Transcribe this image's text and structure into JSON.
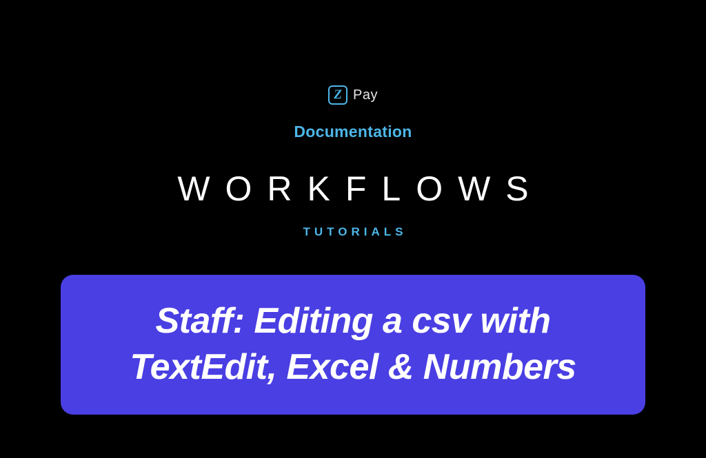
{
  "logo": {
    "letter": "Z",
    "brand": "Pay"
  },
  "labels": {
    "documentation": "Documentation",
    "workflows": "WORKFLOWS",
    "tutorials": "TUTORIALS"
  },
  "banner": {
    "line1": "Staff: Editing a csv with",
    "line2": "TextEdit, Excel & Numbers"
  },
  "colors": {
    "background": "#000000",
    "accent": "#4db6e8",
    "banner_bg": "#4a3fe3",
    "text_light": "#ffffff"
  }
}
